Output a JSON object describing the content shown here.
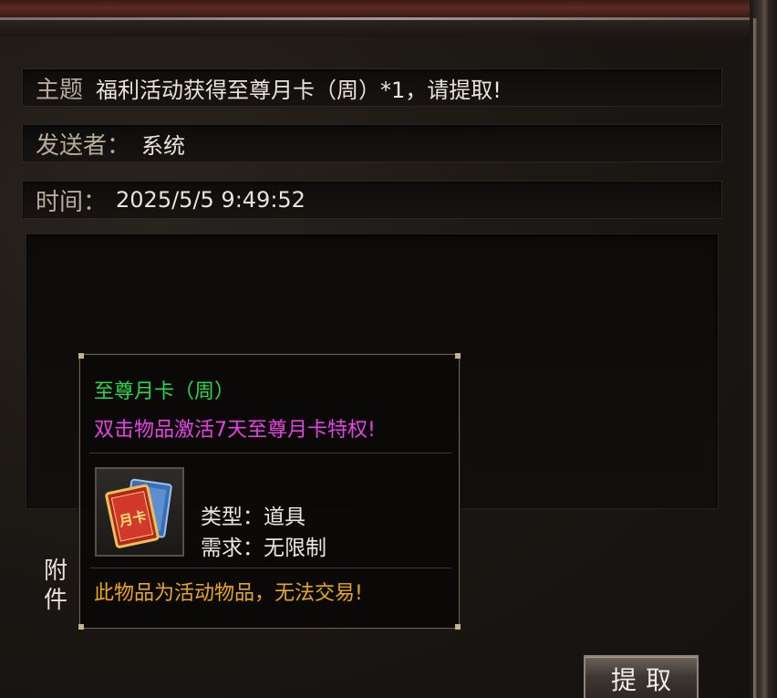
{
  "mail": {
    "subject_label": "主题",
    "subject_value": "福利活动获得至尊月卡（周）*1，请提取!",
    "sender_label": "发送者：",
    "sender_value": "系统",
    "time_label": "时间：",
    "time_value": "2025/5/5 9:49:52",
    "attachment_label": "附件",
    "extract_button_label": "提取"
  },
  "tooltip": {
    "item_name": "至尊月卡（周）",
    "item_description": "双击物品激活7天至尊月卡特权!",
    "icon_name": "monthly-card-icon",
    "icon_text": "月卡",
    "type_line": "类型：道具",
    "requirement_line": "需求：无限制",
    "trade_note": "此物品为活动物品，无法交易!",
    "colors": {
      "name": "#27d84a",
      "description": "#e642e6",
      "note": "#e8a818"
    }
  }
}
